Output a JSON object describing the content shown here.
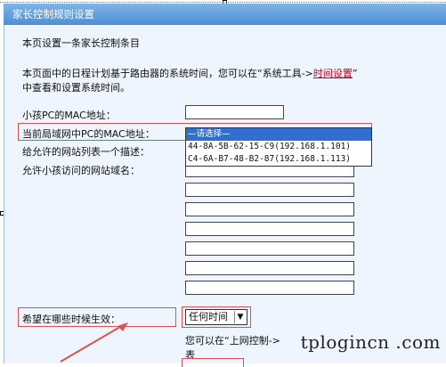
{
  "window": {
    "title": "家长控制规则设置"
  },
  "intro": "本页设置一条家长控制条目",
  "note": {
    "line1_prefix": "本页面中的日程计划基于路由器的系统时间，您可以在“系统工具->",
    "link": "时间设置",
    "line1_suffix": "”",
    "line2": "中查看和设置系统时间。"
  },
  "form": {
    "child_mac_label": "小孩PC的MAC地址：",
    "lan_mac_label": "当前局域网中PC的MAC地址：",
    "allowed_list_desc_label": "给允许的网站列表一个描述：",
    "allowed_domains_label": "允许小孩访问的网站域名：",
    "effective_time_label": "希望在哪些时候生效：",
    "schedule_select_value": "任何时间",
    "hint_line1": "您可以在“上网控制->",
    "hint_line2": "表"
  },
  "dropdown": {
    "options": [
      "—请选择—",
      "44-8A-5B-62-15-C9(192.168.1.101)",
      "C4-6A-B7-48-B2-87(192.168.1.113)"
    ]
  },
  "watermark": "tplogincn .com",
  "colors": {
    "title_bar": "#4e8fd3",
    "panel": "#eef5ff",
    "highlight": "#d9534f",
    "selection": "#2f6fd0",
    "link": "#c4001a"
  },
  "icons": {
    "select_arrow": "chevron-down-icon"
  }
}
